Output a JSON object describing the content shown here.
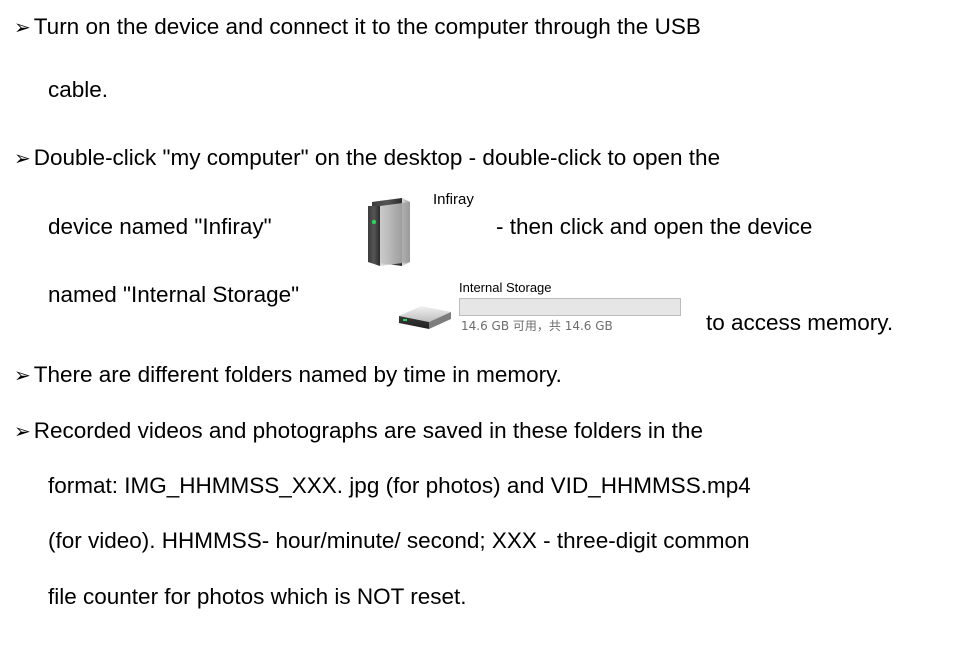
{
  "bullets": {
    "b1": {
      "line1": "Turn on the device and connect it to the computer through the USB",
      "line2": "cable."
    },
    "b2": {
      "line1": "Double-click \"my computer\" on the desktop - double-click to open the",
      "line2_pre": "device named \"Infiray\"",
      "line2_post": "- then click and open the device",
      "line3_pre": "named \"Internal Storage\"",
      "line3_post": "to access memory."
    },
    "b3": {
      "line1": "There are different folders named by time in memory."
    },
    "b4": {
      "line1": "Recorded videos and photographs are saved in these folders in the",
      "line2": "format: IMG_HHMMSS_XXX. jpg (for photos) and VID_HHMMSS.mp4",
      "line3": "(for video). HHMMSS- hour/minute/ second; XXX - three-digit common",
      "line4": "file counter for photos which is NOT reset."
    }
  },
  "device_icon": {
    "name": "Infiray"
  },
  "storage_icon": {
    "name": "Internal Storage",
    "free_text": "14.6 GB 可用，共 14.6 GB",
    "used_fraction": 0.0
  },
  "bullet_marker": "➢",
  "colors": {
    "text": "#000000",
    "bar_border": "#bcbcbc",
    "bar_fill": "#e6e6e6",
    "caption_gray": "#6d6d6d",
    "led_green": "#2bd35a"
  }
}
